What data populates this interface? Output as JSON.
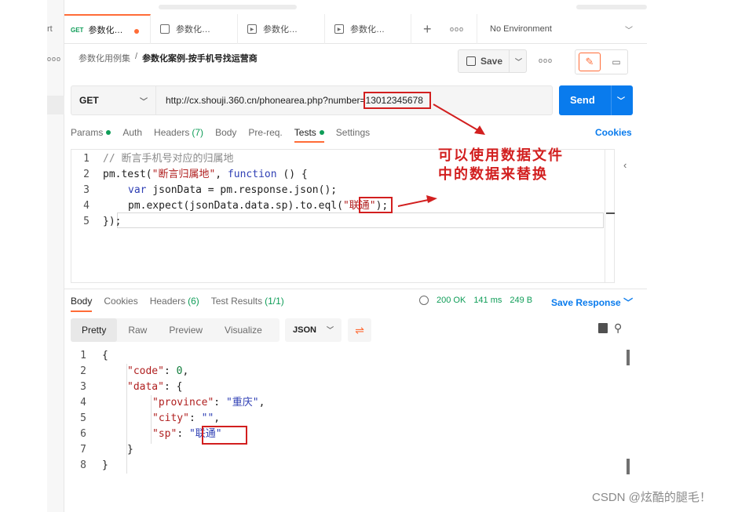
{
  "left_strip": {
    "label": "rt",
    "more": "ooo"
  },
  "tabs": [
    {
      "method": "GET",
      "title": "参数化…",
      "active": true
    },
    {
      "title": "参数化…"
    },
    {
      "title": "参数化…"
    },
    {
      "title": "参数化…"
    }
  ],
  "tabbar": {
    "plus": "+",
    "more": "ooo",
    "environment": "No Environment"
  },
  "breadcrumb": {
    "parent": "参数化用例集",
    "separator": "/",
    "current": "参数化案例-按手机号找运营商"
  },
  "actions": {
    "save_label": "Save",
    "more": "ooo"
  },
  "request": {
    "method": "GET",
    "url_prefix": "http://cx.shouji.360.cn/phonearea.php?number=",
    "url_param": "13012345678",
    "send_label": "Send"
  },
  "request_tabs": [
    {
      "label": "Params",
      "dot": true
    },
    {
      "label": "Auth"
    },
    {
      "label": "Headers",
      "count": "(7)"
    },
    {
      "label": "Body"
    },
    {
      "label": "Pre-req."
    },
    {
      "label": "Tests",
      "dot": true,
      "active": true
    },
    {
      "label": "Settings"
    }
  ],
  "cookies_label": "Cookies",
  "tests_code": {
    "line_numbers": [
      "1",
      "2",
      "3",
      "4",
      "5"
    ],
    "l1_comment": "// 断言手机号对应的归属地",
    "l2_a": "pm.test(",
    "l2_str": "\"断言归属地\"",
    "l2_b": ", ",
    "l2_kw": "function",
    "l2_c": " () {",
    "l3_kw": "var",
    "l3_rest": " jsonData = pm.response.json();",
    "l4_a": "pm.expect(jsonData.data.sp).to.eql(",
    "l4_str": "\"联通\"",
    "l4_b": ");",
    "l5": "});"
  },
  "annotation": {
    "line1": "可以使用数据文件",
    "line2": "中的数据来替换"
  },
  "response_tabs": [
    {
      "label": "Body",
      "active": true
    },
    {
      "label": "Cookies"
    },
    {
      "label": "Headers",
      "count": "(6)"
    },
    {
      "label": "Test Results",
      "count": "(1/1)"
    }
  ],
  "response_meta": {
    "status": "200 OK",
    "time": "141 ms",
    "size": "249 B",
    "save_response": "Save Response"
  },
  "view_modes": [
    "Pretty",
    "Raw",
    "Preview",
    "Visualize"
  ],
  "format": "JSON",
  "response_json": {
    "line_numbers": [
      "1",
      "2",
      "3",
      "4",
      "5",
      "6",
      "7",
      "8"
    ],
    "l1": "{",
    "code_key": "\"code\"",
    "code_val": "0",
    "data_key": "\"data\"",
    "province_key": "\"province\"",
    "province_val": "\"重庆\"",
    "city_key": "\"city\"",
    "city_val": "\"\"",
    "sp_key": "\"sp\"",
    "sp_val": "\"联通\"",
    "l7": "}",
    "l8": "}"
  },
  "watermark": "CSDN @炫酷的腿毛！",
  "colors": {
    "accent": "#ff6c37",
    "send": "#097bed",
    "success": "#0f9d58",
    "annotation": "#d21f1f"
  }
}
